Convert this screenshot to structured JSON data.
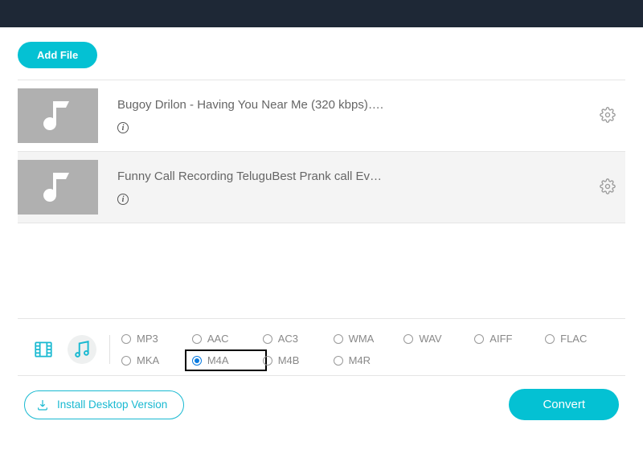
{
  "toolbar": {
    "add_file_label": "Add File"
  },
  "files": [
    {
      "title": "Bugoy Drilon - Having You Near Me (320 kbps)….",
      "selected": false
    },
    {
      "title": "Funny Call Recording TeluguBest Prank call Ev…",
      "selected": true
    }
  ],
  "formats": {
    "row1": [
      "MP3",
      "AAC",
      "AC3",
      "WMA",
      "WAV",
      "AIFF",
      "FLAC"
    ],
    "row2": [
      "MKA",
      "M4A",
      "M4B",
      "M4R"
    ],
    "selected": "M4A",
    "highlighted": "M4A"
  },
  "footer": {
    "install_label": "Install Desktop Version",
    "convert_label": "Convert"
  }
}
